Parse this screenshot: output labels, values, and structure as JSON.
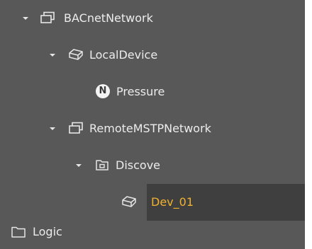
{
  "tree": {
    "items": [
      {
        "label": "BACnetNetwork",
        "icon": "network-icon",
        "expanded": true
      },
      {
        "label": "LocalDevice",
        "icon": "device-icon",
        "expanded": true
      },
      {
        "label": "Pressure",
        "icon": "point-n-icon",
        "badge": "N"
      },
      {
        "label": "RemoteMSTPNetwork",
        "icon": "network-icon",
        "expanded": true
      },
      {
        "label": "Discove",
        "icon": "discover-folder-icon",
        "expanded": true
      },
      {
        "label": "Dev_01",
        "icon": "device-icon",
        "selected": true
      },
      {
        "label": "Logic",
        "icon": "folder-icon"
      }
    ]
  },
  "colors": {
    "panel_bg": "#585858",
    "text": "#ececec",
    "selected_text": "#f0b230",
    "selected_bg": "#3f3f3f"
  }
}
